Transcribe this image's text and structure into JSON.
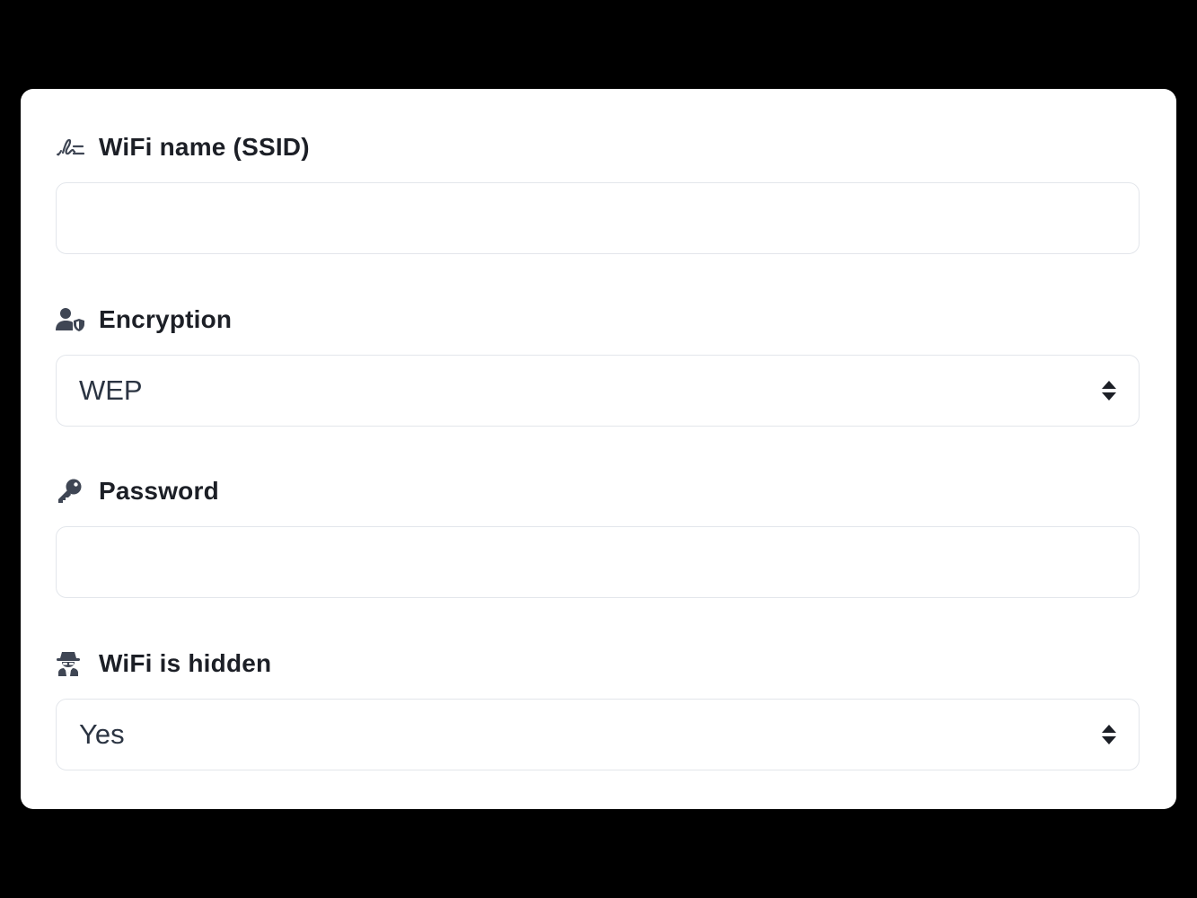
{
  "form": {
    "ssid": {
      "label": "WiFi name (SSID)",
      "icon": "signature-icon",
      "value": "",
      "placeholder": ""
    },
    "encryption": {
      "label": "Encryption",
      "icon": "user-shield-icon",
      "selected": "WEP"
    },
    "password": {
      "label": "Password",
      "icon": "key-icon",
      "value": "",
      "placeholder": ""
    },
    "hidden": {
      "label": "WiFi is hidden",
      "icon": "user-secret-icon",
      "selected": "Yes"
    }
  },
  "colors": {
    "background": "#000000",
    "card": "#ffffff",
    "border": "#e3e6eb",
    "label_text": "#1c1f26",
    "value_text": "#2b3442",
    "icon": "#3f4654"
  }
}
